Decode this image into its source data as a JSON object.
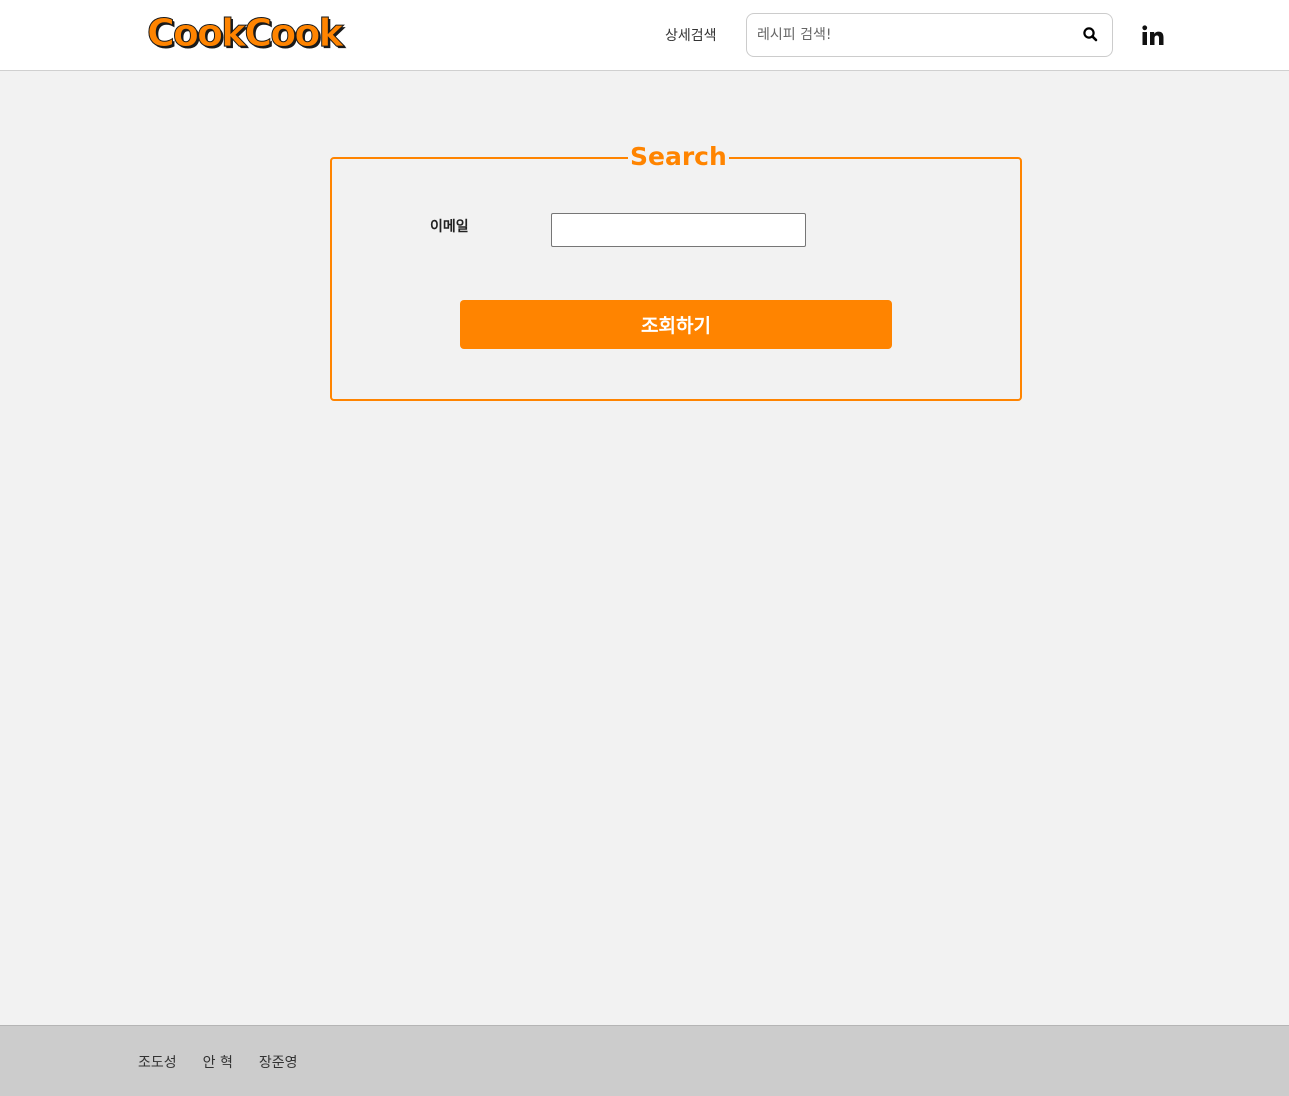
{
  "header": {
    "logo_text": "CookCook",
    "advanced_search_label": "상세검색",
    "search_placeholder": "레시피 검색!",
    "search_value": "",
    "search_icon": "search-icon",
    "social_icon": "linkedin-icon"
  },
  "form": {
    "legend": "Search",
    "email_label": "이메일",
    "email_value": "",
    "submit_label": "조회하기"
  },
  "footer": {
    "members": [
      "조도성",
      "안 혁",
      "장준영"
    ]
  },
  "colors": {
    "accent": "#ff8400",
    "background": "#f2f2f2",
    "footer": "#cccccc"
  }
}
